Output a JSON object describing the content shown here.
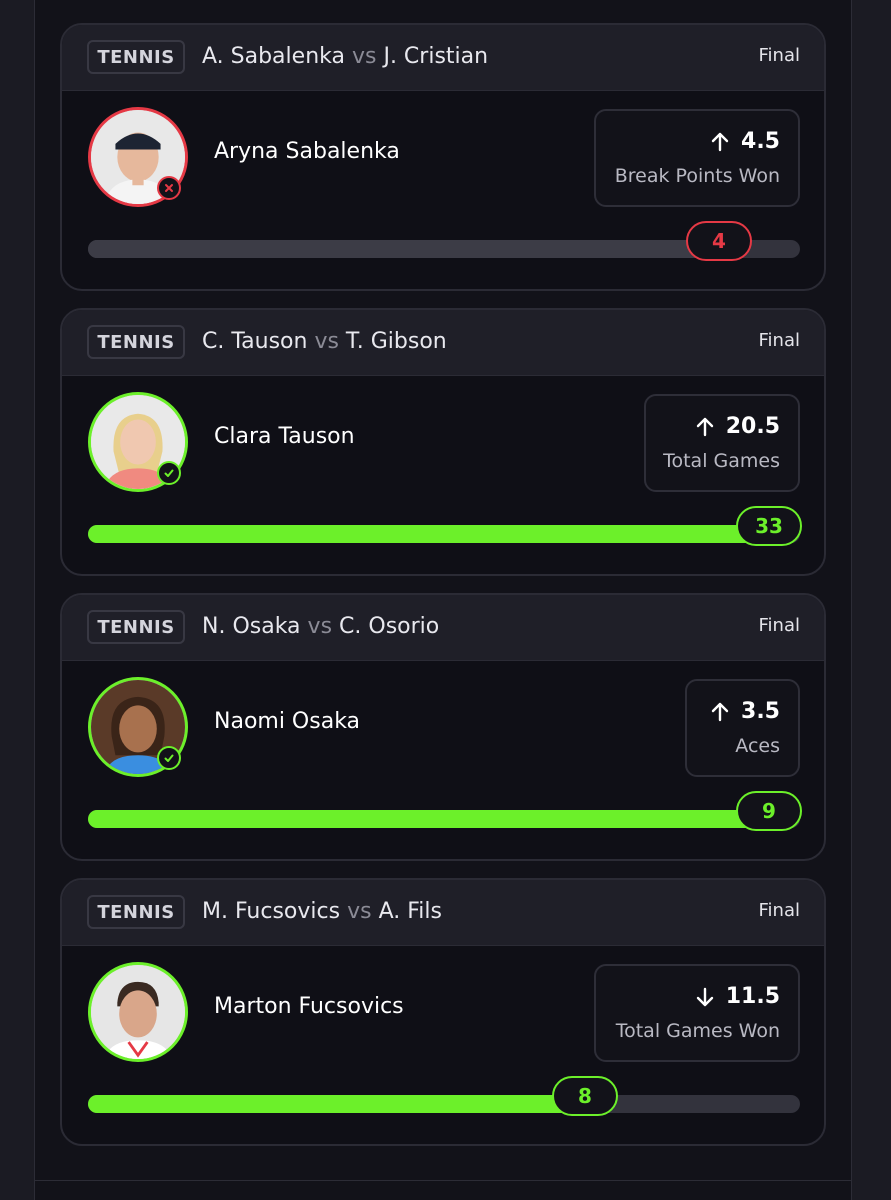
{
  "cards": [
    {
      "sport": "TENNIS",
      "player_a": "A. Sabalenka",
      "vs": "vs",
      "player_b": "J. Cristian",
      "status": "Final",
      "player_name": "Aryna Sabalenka",
      "direction": "up",
      "direction_icon": "arrow-up-icon",
      "line": "4.5",
      "stat": "Break Points Won",
      "actual": "4",
      "outcome": "lost",
      "progress_fraction": 0.89,
      "colors": {
        "ring": "#e53945"
      }
    },
    {
      "sport": "TENNIS",
      "player_a": "C. Tauson",
      "vs": "vs",
      "player_b": "T. Gibson",
      "status": "Final",
      "player_name": "Clara Tauson",
      "direction": "up",
      "direction_icon": "arrow-up-icon",
      "line": "20.5",
      "stat": "Total Games",
      "actual": "33",
      "outcome": "won",
      "progress_fraction": 1.0,
      "colors": {
        "ring": "#6cf02a"
      }
    },
    {
      "sport": "TENNIS",
      "player_a": "N. Osaka",
      "vs": "vs",
      "player_b": "C. Osorio",
      "status": "Final",
      "player_name": "Naomi Osaka",
      "direction": "up",
      "direction_icon": "arrow-up-icon",
      "line": "3.5",
      "stat": "Aces",
      "actual": "9",
      "outcome": "won",
      "progress_fraction": 1.0,
      "colors": {
        "ring": "#6cf02a"
      }
    },
    {
      "sport": "TENNIS",
      "player_a": "M. Fucsovics",
      "vs": "vs",
      "player_b": "A. Fils",
      "status": "Final",
      "player_name": "Marton Fucsovics",
      "direction": "down",
      "direction_icon": "arrow-down-icon",
      "line": "11.5",
      "stat": "Total Games Won",
      "actual": "8",
      "outcome": "won",
      "progress_fraction": 0.7,
      "colors": {
        "ring": "#6cf02a"
      }
    }
  ],
  "theme": {
    "background": "#121219",
    "win_color": "#6cf02a",
    "loss_color": "#e53945"
  }
}
